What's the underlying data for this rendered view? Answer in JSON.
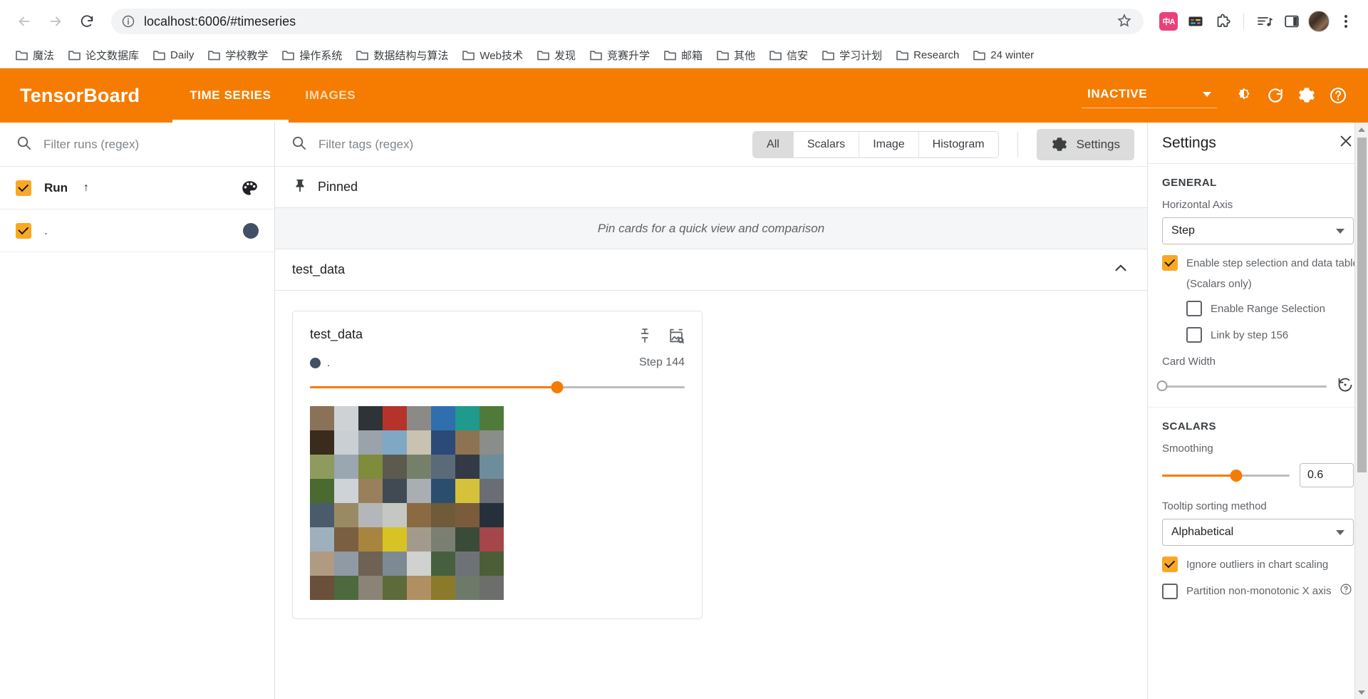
{
  "browser": {
    "back_label": "Back",
    "forward_label": "Forward",
    "reload_label": "Reload",
    "url": "localhost:6006/#timeseries",
    "bookmark_star_label": "Bookmark this tab",
    "toolbar_icons": [
      {
        "name": "translate-icon",
        "glyph": "中A"
      },
      {
        "name": "card-note-icon",
        "glyph": ""
      },
      {
        "name": "extensions-icon",
        "glyph": ""
      },
      {
        "name": "music-list-icon",
        "glyph": ""
      },
      {
        "name": "side-panel-icon",
        "glyph": ""
      },
      {
        "name": "profile-avatar",
        "glyph": ""
      },
      {
        "name": "chrome-menu-icon",
        "glyph": ""
      }
    ],
    "bookmarks": [
      "魔法",
      "论文数据库",
      "Daily",
      "学校教学",
      "操作系统",
      "数据结构与算法",
      "Web技术",
      "发现",
      "竞赛升学",
      "邮箱",
      "其他",
      "信安",
      "学习计划",
      "Research",
      "24 winter"
    ]
  },
  "tb_header": {
    "brand": "TensorBoard",
    "tabs": [
      {
        "label": "TIME SERIES",
        "active": true
      },
      {
        "label": "IMAGES",
        "active": false
      }
    ],
    "status": "INACTIVE",
    "icons": [
      {
        "name": "brightness-icon"
      },
      {
        "name": "refresh-icon"
      },
      {
        "name": "settings-gear-icon"
      },
      {
        "name": "help-icon"
      }
    ],
    "accent_color": "#f57c00"
  },
  "runs_pane": {
    "filter_placeholder": "Filter runs (regex)",
    "header": {
      "label": "Run",
      "sort_arrow": "↑",
      "palette_icon": "color-palette-icon"
    },
    "runs": [
      {
        "label": ".",
        "checked": true,
        "color": "#425066"
      }
    ]
  },
  "tags_toolbar": {
    "filter_placeholder": "Filter tags (regex)",
    "chips": [
      {
        "label": "All",
        "active": true
      },
      {
        "label": "Scalars",
        "active": false
      },
      {
        "label": "Image",
        "active": false
      },
      {
        "label": "Histogram",
        "active": false
      }
    ],
    "settings_button": "Settings"
  },
  "pinned": {
    "title": "Pinned",
    "empty_message": "Pin cards for a quick view and comparison"
  },
  "group": {
    "title": "test_data"
  },
  "card": {
    "title": "test_data",
    "run_label": ".",
    "run_color": "#425066",
    "step_label": "Step 144",
    "slider_percent": 66,
    "pin_icon": "pin-icon",
    "expand_icon": "image-search-icon",
    "image_grid": {
      "rows": 8,
      "cols": 8,
      "tiles": [
        "#8a7258",
        "#cfd2d4",
        "#2e3338",
        "#b5332a",
        "#8c8a86",
        "#2f6fae",
        "#1f9a8c",
        "#4f7a3a",
        "#3a2c1c",
        "#c9cfd2",
        "#9aa3ab",
        "#7fa8c4",
        "#c9c2b0",
        "#2b4a78",
        "#8e7352",
        "#8a8d8a",
        "#8f9b5e",
        "#9aa6b0",
        "#7e8c3c",
        "#5c5a4e",
        "#74806a",
        "#5b6a78",
        "#333a45",
        "#6d8d9c",
        "#4b6a32",
        "#cdd3d6",
        "#9a7f5c",
        "#3f4a54",
        "#a9aeb2",
        "#2c4e6e",
        "#d6c23a",
        "#6a6e74",
        "#4a5b6b",
        "#9a8a63",
        "#b4b7ba",
        "#c5c8c2",
        "#8a6a42",
        "#6f5a3a",
        "#7a5c3c",
        "#26303a",
        "#9fb0bd",
        "#7a5f42",
        "#a8853f",
        "#d8c324",
        "#a39a8e",
        "#7a7f72",
        "#3a4b38",
        "#a4464a",
        "#b09a82",
        "#8f9aa4",
        "#6d6254",
        "#7d8a94",
        "#cfd2cf",
        "#46603f",
        "#6e7277",
        "#4b5e37",
        "#6a4f3a",
        "#4c6a3e",
        "#8c8378",
        "#5d6a3a",
        "#b08f63",
        "#8a7a2a",
        "#6d7a6a",
        "#6c6e6c"
      ]
    }
  },
  "settings": {
    "title": "Settings",
    "close_label": "Close settings",
    "general": {
      "section_title": "GENERAL",
      "horizontal_axis_label": "Horizontal Axis",
      "horizontal_axis_value": "Step",
      "step_selection_label": "Enable step selection and data table",
      "step_selection_checked": true,
      "scalars_only_note": "(Scalars only)",
      "range_selection_label": "Enable Range Selection",
      "range_selection_checked": false,
      "link_by_step_label": "Link by step 156",
      "link_by_step_checked": false,
      "card_width_label": "Card Width",
      "card_width_percent": 0,
      "reset_icon": "reset-card-width-icon"
    },
    "scalars": {
      "section_title": "SCALARS",
      "smoothing_label": "Smoothing",
      "smoothing_value": "0.6",
      "smoothing_percent": 58,
      "tooltip_sort_label": "Tooltip sorting method",
      "tooltip_sort_value": "Alphabetical",
      "ignore_outliers_label": "Ignore outliers in chart scaling",
      "ignore_outliers_checked": true,
      "partition_label": "Partition non-monotonic X axis",
      "partition_checked": false,
      "partition_help_icon": "help-circle-icon"
    }
  }
}
